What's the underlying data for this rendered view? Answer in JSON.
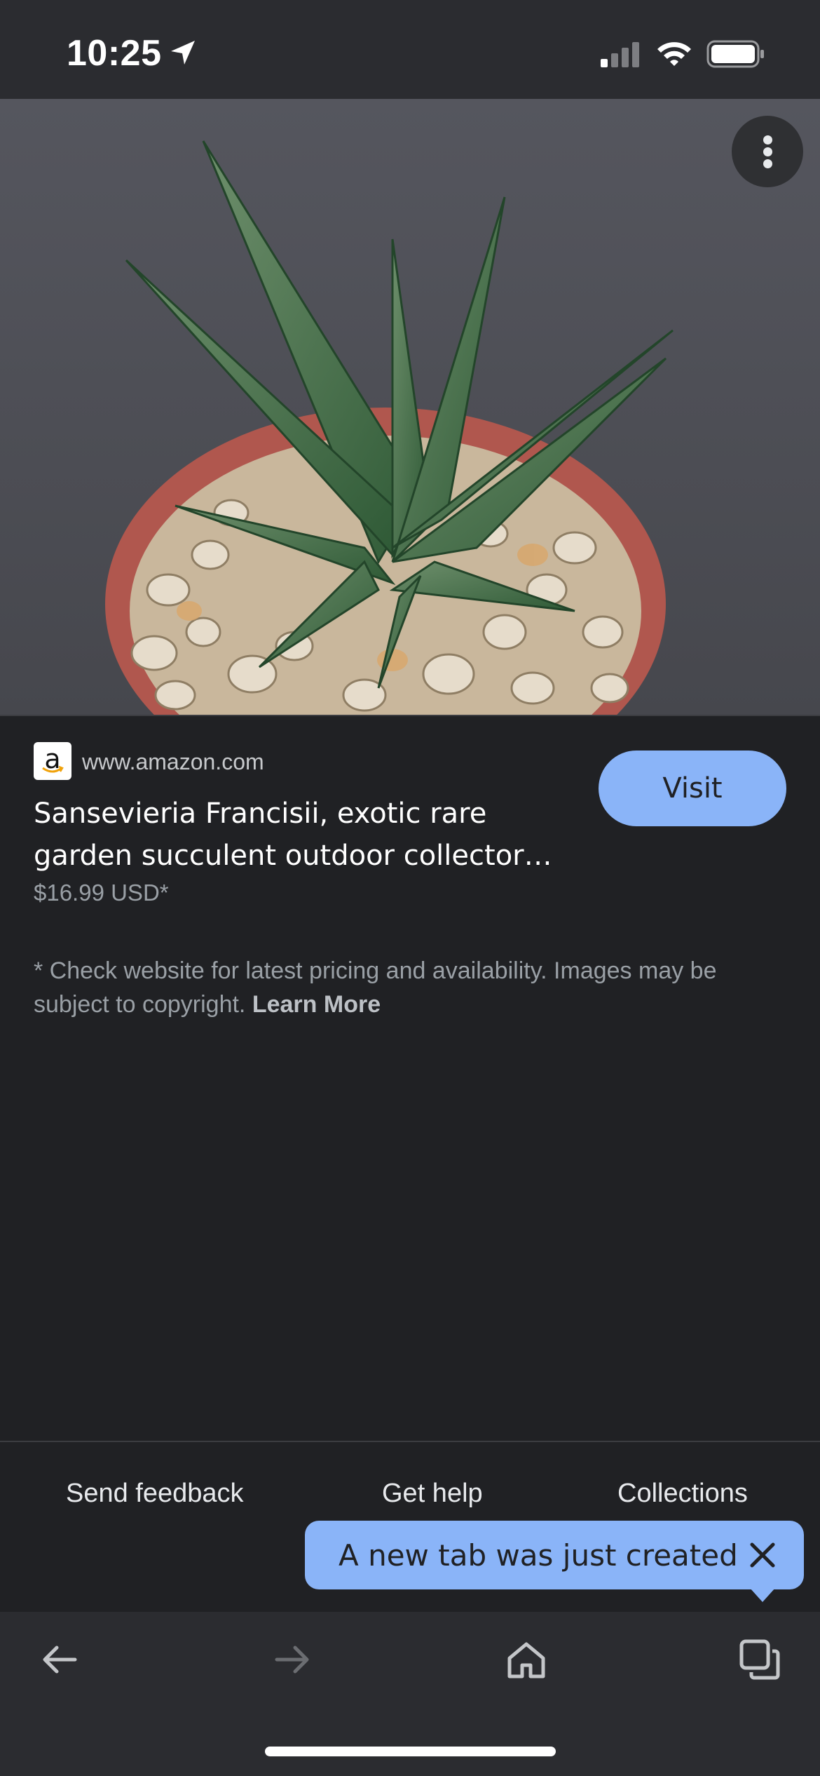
{
  "status_bar": {
    "time": "10:25",
    "location_icon": "location-arrow-icon",
    "signal_icon": "cellular-signal-icon",
    "wifi_icon": "wifi-icon",
    "battery_icon": "battery-icon"
  },
  "hero": {
    "image_subject": "potted succulent plant on pebbles",
    "menu_icon": "more-vert-icon"
  },
  "result": {
    "favicon_icon": "amazon-logo-icon",
    "favicon_letter": "a",
    "domain": "www.amazon.com",
    "title": "Sansevieria Francisii, exotic rare garden succulent outdoor collector…",
    "price": "$16.99 USD*",
    "visit_label": "Visit",
    "disclaimer": "* Check website for latest pricing and availability. Images may be subject to copyright.",
    "learn_more": "Learn More"
  },
  "footer": {
    "send_feedback": "Send feedback",
    "get_help": "Get help",
    "collections": "Collections"
  },
  "toast": {
    "message": "A new tab was just created",
    "close_icon": "close-icon"
  },
  "toolbar": {
    "back_icon": "back-arrow-icon",
    "forward_icon": "forward-arrow-icon",
    "home_icon": "home-icon",
    "tabs_icon": "tab-switcher-icon"
  },
  "colors": {
    "background": "#202124",
    "bar": "#2b2c30",
    "accent": "#8ab4f8",
    "secondary_text": "#9aa0a6"
  }
}
